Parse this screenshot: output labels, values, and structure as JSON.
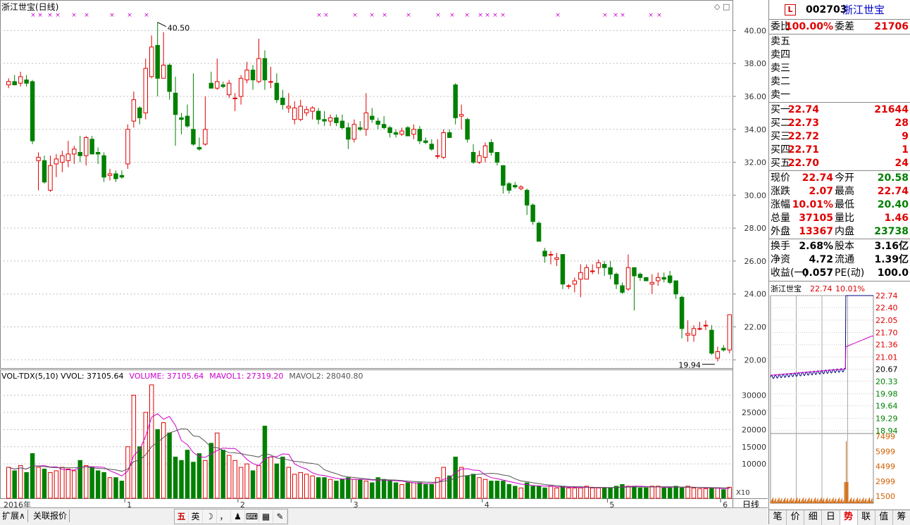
{
  "chart": {
    "title": "浙江世宝(日线)",
    "high_label": "40.50",
    "low_label": "19.94",
    "price_ticks": [
      "40.00",
      "38.00",
      "36.00",
      "34.00",
      "32.00",
      "30.00",
      "28.00",
      "26.00",
      "24.00",
      "22.00",
      "20.00"
    ],
    "vol_header": "VOL-TDX(5,10)  VVOL: 37105.64",
    "vol_volume": "VOLUME: 37105.64",
    "vol_mavol1": "MAVOL1: 27319.20",
    "vol_mavol2": "MAVOL2: 28040.80",
    "vol_ticks": [
      "30000",
      "25000",
      "20000",
      "15000",
      "10000"
    ],
    "x_labels": [
      "2016年",
      "1",
      "2",
      "3",
      "4",
      "5",
      "6"
    ],
    "unit_label": "X10",
    "period_label": "日线",
    "colors": {
      "up": "#e00000",
      "down": "#008000",
      "grid": "#c0c0c0",
      "ma1": "#cc00cc",
      "ma2": "#555555"
    }
  },
  "chart_data": {
    "type": "candlestick",
    "price_range": [
      19.5,
      41
    ],
    "ohlc": [
      [
        36.7,
        37.1,
        36.5,
        36.9
      ],
      [
        36.9,
        37.3,
        36.7,
        36.7
      ],
      [
        36.8,
        37.5,
        36.6,
        37.2
      ],
      [
        37.0,
        37.3,
        36.6,
        36.8
      ],
      [
        36.9,
        37.0,
        33.1,
        33.3
      ],
      [
        32.1,
        32.6,
        30.3,
        32.3
      ],
      [
        32.1,
        32.4,
        30.7,
        30.8
      ],
      [
        30.3,
        32.4,
        30.2,
        31.8
      ],
      [
        31.9,
        32.5,
        31.1,
        32.2
      ],
      [
        32.0,
        32.7,
        31.4,
        32.4
      ],
      [
        32.1,
        33.3,
        31.7,
        32.5
      ],
      [
        32.5,
        33.0,
        31.9,
        32.8
      ],
      [
        32.6,
        33.6,
        32.0,
        32.4
      ],
      [
        32.4,
        33.6,
        31.8,
        33.5
      ],
      [
        33.4,
        33.6,
        32.5,
        32.5
      ],
      [
        32.6,
        32.9,
        31.9,
        32.5
      ],
      [
        32.4,
        32.6,
        30.8,
        31.1
      ],
      [
        31.2,
        31.6,
        30.9,
        31.3
      ],
      [
        31.3,
        31.5,
        30.8,
        31.0
      ],
      [
        31.2,
        31.5,
        31.0,
        31.1
      ],
      [
        31.9,
        34.3,
        31.6,
        34.0
      ],
      [
        34.5,
        36.3,
        34.1,
        35.8
      ],
      [
        35.3,
        35.4,
        34.3,
        34.7
      ],
      [
        35.0,
        38.3,
        34.6,
        37.7
      ],
      [
        37.2,
        39.7,
        37.1,
        39.0
      ],
      [
        39.1,
        40.5,
        36.0,
        37.1
      ],
      [
        37.1,
        39.9,
        37.1,
        37.9
      ],
      [
        37.9,
        38.0,
        35.8,
        36.3
      ],
      [
        36.2,
        37.2,
        33.0,
        34.9
      ],
      [
        34.7,
        35.0,
        33.7,
        34.6
      ],
      [
        34.8,
        35.5,
        34.1,
        34.2
      ],
      [
        34.0,
        37.4,
        33.0,
        33.1
      ],
      [
        32.9,
        33.5,
        32.7,
        32.8
      ],
      [
        33.1,
        36.0,
        33.0,
        34.0
      ],
      [
        36.8,
        37.5,
        36.6,
        36.5
      ],
      [
        36.5,
        38.3,
        36.4,
        36.9
      ],
      [
        36.7,
        36.9,
        36.5,
        36.6
      ],
      [
        36.1,
        37.0,
        35.9,
        36.8
      ],
      [
        35.9,
        36.2,
        35.1,
        35.9
      ],
      [
        36.0,
        37.3,
        35.5,
        37.1
      ],
      [
        37.0,
        38.1,
        36.8,
        37.6
      ],
      [
        37.6,
        37.9,
        36.4,
        37.0
      ],
      [
        36.9,
        39.5,
        36.8,
        38.3
      ],
      [
        38.3,
        38.8,
        36.4,
        37.0
      ],
      [
        36.9,
        37.8,
        36.5,
        36.9
      ],
      [
        36.8,
        37.4,
        35.6,
        35.8
      ],
      [
        35.9,
        36.4,
        35.2,
        35.5
      ],
      [
        35.3,
        36.2,
        35.0,
        35.4
      ],
      [
        34.6,
        35.7,
        34.3,
        35.3
      ],
      [
        34.6,
        35.8,
        34.5,
        35.4
      ],
      [
        35.0,
        35.4,
        34.8,
        35.2
      ],
      [
        35.1,
        35.4,
        34.6,
        35.3
      ],
      [
        35.1,
        35.3,
        34.3,
        34.6
      ],
      [
        34.6,
        35.1,
        34.2,
        34.5
      ],
      [
        34.5,
        34.9,
        34.2,
        34.7
      ],
      [
        34.7,
        34.9,
        34.2,
        34.4
      ],
      [
        34.5,
        34.9,
        34.0,
        34.1
      ],
      [
        34.1,
        34.4,
        32.8,
        33.4
      ],
      [
        33.4,
        34.6,
        33.2,
        34.3
      ],
      [
        34.1,
        34.5,
        33.9,
        34.0
      ],
      [
        34.0,
        36.2,
        33.6,
        35.0
      ],
      [
        34.8,
        35.3,
        34.4,
        34.6
      ],
      [
        34.5,
        34.7,
        34.0,
        34.3
      ],
      [
        34.3,
        34.8,
        34.0,
        34.1
      ],
      [
        34.1,
        34.2,
        33.5,
        33.8
      ],
      [
        33.8,
        34.0,
        33.5,
        33.7
      ],
      [
        33.7,
        34.1,
        33.6,
        33.9
      ],
      [
        34.1,
        34.2,
        33.6,
        33.6
      ],
      [
        33.7,
        34.3,
        33.4,
        34.0
      ],
      [
        34.0,
        34.2,
        33.1,
        33.3
      ],
      [
        33.3,
        33.5,
        33.1,
        33.2
      ],
      [
        33.1,
        33.4,
        32.7,
        32.8
      ],
      [
        32.4,
        33.4,
        32.2,
        32.4
      ],
      [
        32.3,
        34.0,
        32.2,
        33.8
      ],
      [
        33.8,
        34.0,
        33.6,
        33.5
      ],
      [
        36.7,
        36.8,
        34.3,
        34.7
      ],
      [
        34.8,
        35.5,
        34.0,
        34.9
      ],
      [
        34.6,
        34.7,
        33.2,
        33.4
      ],
      [
        32.6,
        33.1,
        31.9,
        32.0
      ],
      [
        32.0,
        32.7,
        31.9,
        32.4
      ],
      [
        32.3,
        33.2,
        32.0,
        33.0
      ],
      [
        33.2,
        33.4,
        32.4,
        32.6
      ],
      [
        32.6,
        32.6,
        31.8,
        32.0
      ],
      [
        31.8,
        31.8,
        30.1,
        30.6
      ],
      [
        30.7,
        30.8,
        30.1,
        30.3
      ],
      [
        30.6,
        30.8,
        30.4,
        30.5
      ],
      [
        30.4,
        30.6,
        30.3,
        30.5
      ],
      [
        30.3,
        30.4,
        28.8,
        29.4
      ],
      [
        29.4,
        29.5,
        28.2,
        28.4
      ],
      [
        28.3,
        28.4,
        27.2,
        27.2
      ],
      [
        26.6,
        26.8,
        25.9,
        26.3
      ],
      [
        26.4,
        26.6,
        25.8,
        26.4
      ],
      [
        26.1,
        26.5,
        25.7,
        26.2
      ],
      [
        26.4,
        26.4,
        24.3,
        24.6
      ],
      [
        24.5,
        24.6,
        24.3,
        24.5
      ],
      [
        24.6,
        25.0,
        24.1,
        24.8
      ],
      [
        24.9,
        25.8,
        23.8,
        25.3
      ],
      [
        24.9,
        25.8,
        24.9,
        25.6
      ],
      [
        25.4,
        25.8,
        25.2,
        25.4
      ],
      [
        25.6,
        26.1,
        25.2,
        25.9
      ],
      [
        25.8,
        26.0,
        25.1,
        25.6
      ],
      [
        25.6,
        26.0,
        24.9,
        25.2
      ],
      [
        25.2,
        25.3,
        24.3,
        24.6
      ],
      [
        24.5,
        24.7,
        24.0,
        24.1
      ],
      [
        24.3,
        26.4,
        24.2,
        25.6
      ],
      [
        25.6,
        25.6,
        23.0,
        25.1
      ],
      [
        25.2,
        25.3,
        24.8,
        25.0
      ],
      [
        25.0,
        25.0,
        24.8,
        24.8
      ],
      [
        24.6,
        25.2,
        24.0,
        24.7
      ],
      [
        24.8,
        25.3,
        24.5,
        25.0
      ],
      [
        25.0,
        25.3,
        24.7,
        24.9
      ],
      [
        25.1,
        25.4,
        24.6,
        24.7
      ],
      [
        24.8,
        24.8,
        23.7,
        24.0
      ],
      [
        23.8,
        23.9,
        21.3,
        21.9
      ],
      [
        21.5,
        22.4,
        21.1,
        21.6
      ],
      [
        21.5,
        22.1,
        21.1,
        21.9
      ],
      [
        21.9,
        22.3,
        21.8,
        21.9
      ],
      [
        22.1,
        22.4,
        21.8,
        22.1
      ],
      [
        21.8,
        22.1,
        20.3,
        20.4
      ],
      [
        20.1,
        20.8,
        19.9,
        20.5
      ],
      [
        20.7,
        20.9,
        20.5,
        20.6
      ],
      [
        20.6,
        22.74,
        20.4,
        22.74
      ]
    ],
    "volume": [
      9000,
      8000,
      9500,
      7500,
      13000,
      9000,
      8500,
      7500,
      8000,
      9000,
      8500,
      8000,
      11000,
      9500,
      9000,
      8000,
      7500,
      6000,
      6000,
      5000,
      15000,
      30000,
      15000,
      25000,
      33000,
      20000,
      22000,
      19000,
      12000,
      11000,
      14000,
      10500,
      13000,
      11000,
      16000,
      19000,
      14000,
      12500,
      11000,
      9000,
      10000,
      8000,
      9500,
      21000,
      12000,
      10000,
      12000,
      9000,
      7000,
      7500,
      7000,
      6500,
      6000,
      6000,
      5500,
      5000,
      5500,
      6000,
      5500,
      5500,
      5000,
      4500,
      6000,
      5500,
      5000,
      4500,
      4000,
      4500,
      4500,
      4500,
      4000,
      4000,
      6000,
      9000,
      6500,
      12000,
      9000,
      6500,
      7000,
      6000,
      5500,
      5000,
      5000,
      5000,
      4000,
      3500,
      3000,
      4500,
      3500,
      3500,
      3000,
      3500,
      3000,
      3500,
      3000,
      3000,
      3000,
      3500,
      3000,
      3000,
      3000,
      3000,
      3500,
      4000,
      3500,
      3500,
      3000,
      3000,
      3500,
      3500,
      3000,
      3000,
      3500,
      3000,
      3500,
      3000,
      2800,
      2800,
      3000,
      3000,
      2500,
      3200
    ],
    "stars": [
      47,
      57,
      71,
      82,
      105,
      123,
      159,
      184,
      208,
      453,
      463,
      504,
      528,
      546,
      580,
      622,
      642,
      663,
      682,
      692,
      703,
      714,
      792,
      859,
      874,
      884,
      924,
      936
    ]
  },
  "right": {
    "code": "002703",
    "name": "浙江世宝",
    "wb_label": "委比",
    "wb_value": "100.00%",
    "wc_label": "委差",
    "wc_value": "21706",
    "sell": [
      {
        "label": "卖五"
      },
      {
        "label": "卖四"
      },
      {
        "label": "卖三"
      },
      {
        "label": "卖二"
      },
      {
        "label": "卖一"
      }
    ],
    "buy": [
      {
        "label": "买一",
        "price": "22.74",
        "vol": "21644"
      },
      {
        "label": "买二",
        "price": "22.73",
        "vol": "28"
      },
      {
        "label": "买三",
        "price": "22.72",
        "vol": "9"
      },
      {
        "label": "买四",
        "price": "22.71",
        "vol": "1"
      },
      {
        "label": "买五",
        "price": "22.70",
        "vol": "24"
      }
    ],
    "quote": [
      {
        "l1": "现价",
        "v1": "22.74",
        "c1": "red",
        "l2": "今开",
        "v2": "20.58",
        "c2": "green"
      },
      {
        "l1": "涨跌",
        "v1": "2.07",
        "c1": "red",
        "l2": "最高",
        "v2": "22.74",
        "c2": "red"
      },
      {
        "l1": "涨幅",
        "v1": "10.01%",
        "c1": "red",
        "l2": "最低",
        "v2": "20.40",
        "c2": "green"
      },
      {
        "l1": "总量",
        "v1": "37105",
        "c1": "red",
        "l2": "量比",
        "v2": "1.46",
        "c2": "red"
      },
      {
        "l1": "外盘",
        "v1": "13367",
        "c1": "red",
        "l2": "内盘",
        "v2": "23738",
        "c2": "green"
      }
    ],
    "fund": [
      {
        "l1": "换手",
        "v1": "2.68%",
        "l2": "股本",
        "v2": "3.16亿"
      },
      {
        "l1": "净资",
        "v1": "4.72",
        "l2": "流通",
        "v2": "1.39亿"
      },
      {
        "l1": "收益(一)",
        "v1": "0.057",
        "l2": "PE(动)",
        "v2": "100.0"
      }
    ],
    "mini_title": "浙江世宝",
    "mini_price": "22.74",
    "mini_pct": "10.01%",
    "mini_price_ticks": [
      "22.74",
      "22.40",
      "22.05",
      "21.70",
      "21.36",
      "21.01",
      "20.67",
      "20.33",
      "19.98",
      "19.64",
      "19.29",
      "18.94"
    ],
    "mini_vol_ticks": [
      "7499",
      "5999",
      "4499",
      "2999",
      "1500"
    ],
    "tabs": [
      "笔",
      "价",
      "细",
      "日",
      "势",
      "联",
      "值",
      "筹"
    ],
    "active_tab": "势"
  },
  "bottom": {
    "tabs": [
      "扩展∧",
      "关联报价"
    ],
    "toolbar": [
      "五",
      "英",
      "☽",
      "，",
      "♟",
      "⌨",
      "▦",
      "✎"
    ]
  }
}
